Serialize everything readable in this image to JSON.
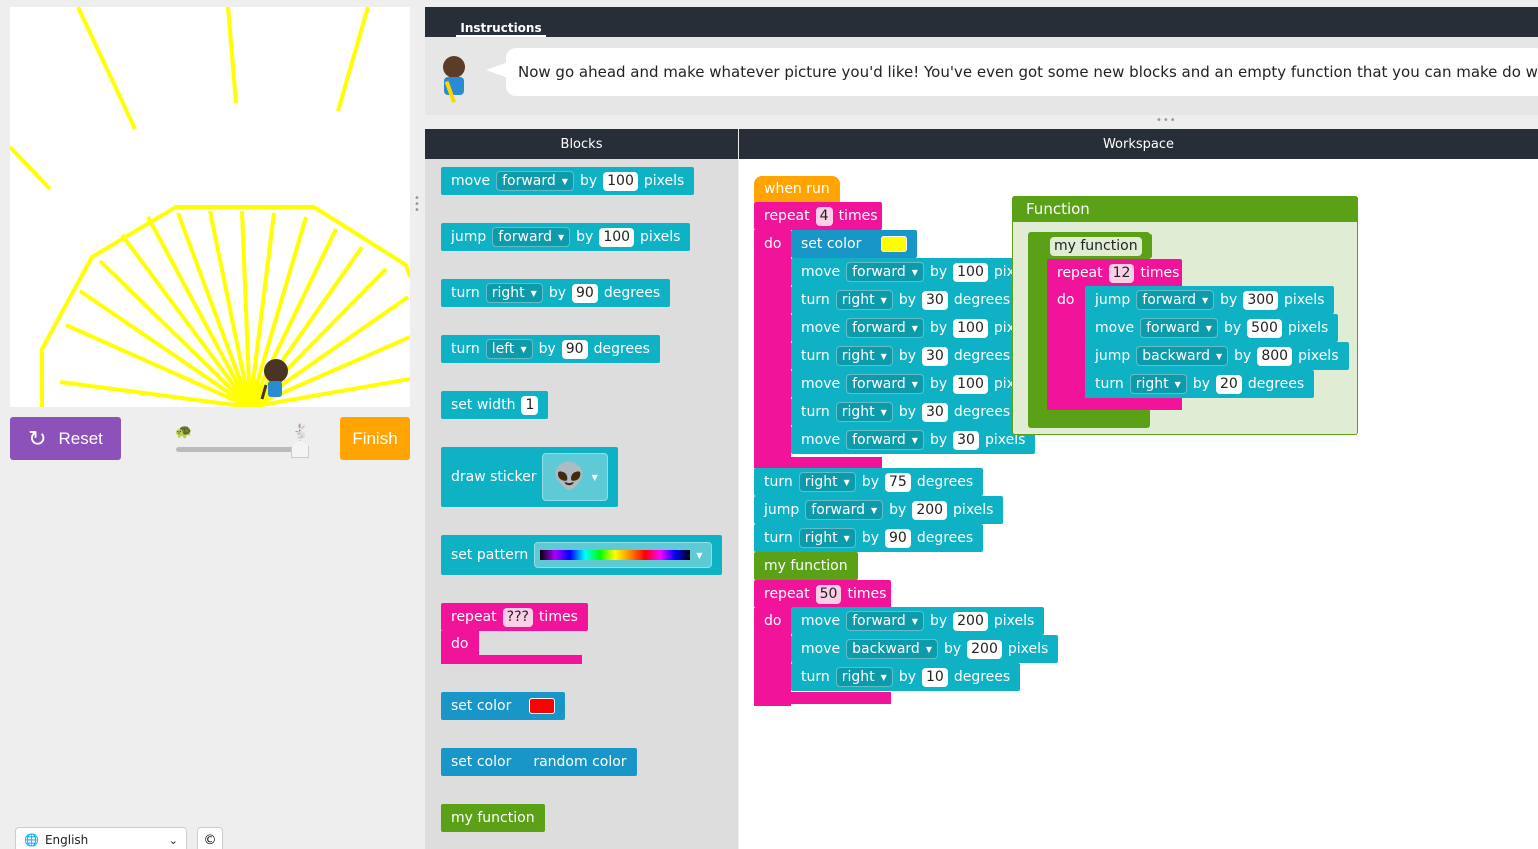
{
  "colors": {
    "reset": "#8c52ba",
    "finish": "#ffa400",
    "sun": "#ffff00"
  },
  "stage": {
    "reset_label": "Reset",
    "finish_label": "Finish"
  },
  "footer": {
    "language": "English",
    "copyright": "©"
  },
  "instructions": {
    "tab": "Instructions",
    "text": "Now go ahead and make whatever picture you'd like! You've even got some new blocks and an empty function that you can make do whatever"
  },
  "headers": {
    "blocks": "Blocks",
    "workspace": "Workspace"
  },
  "toolbox": {
    "move": {
      "verb": "move",
      "dir": "forward",
      "by": "by",
      "value": "100",
      "unit": "pixels"
    },
    "jump": {
      "verb": "jump",
      "dir": "forward",
      "by": "by",
      "value": "100",
      "unit": "pixels"
    },
    "turn_right": {
      "verb": "turn",
      "dir": "right",
      "by": "by",
      "value": "90",
      "unit": "degrees"
    },
    "turn_left": {
      "verb": "turn",
      "dir": "left",
      "by": "by",
      "value": "90",
      "unit": "degrees"
    },
    "set_width": {
      "label": "set width",
      "value": "1"
    },
    "draw_sticker": {
      "label": "draw sticker"
    },
    "set_pattern": {
      "label": "set pattern"
    },
    "repeat": {
      "label": "repeat",
      "value": "???",
      "times": "times",
      "do": "do"
    },
    "set_color_red": {
      "label": "set color",
      "color": "#ff0000"
    },
    "set_color_random": {
      "label": "set color",
      "value": "random color"
    },
    "my_function": {
      "label": "my function"
    }
  },
  "workspace": {
    "when_run": "when run",
    "repeat1": {
      "label": "repeat",
      "value": "4",
      "times": "times",
      "do": "do"
    },
    "set_color": {
      "label": "set color",
      "color": "#ffff00"
    },
    "inner": [
      {
        "verb": "move",
        "dir": "forward",
        "by": "by",
        "value": "100",
        "unit": "pixels"
      },
      {
        "verb": "turn",
        "dir": "right",
        "by": "by",
        "value": "30",
        "unit": "degrees"
      },
      {
        "verb": "move",
        "dir": "forward",
        "by": "by",
        "value": "100",
        "unit": "pixels"
      },
      {
        "verb": "turn",
        "dir": "right",
        "by": "by",
        "value": "30",
        "unit": "degrees"
      },
      {
        "verb": "move",
        "dir": "forward",
        "by": "by",
        "value": "100",
        "unit": "pixels"
      },
      {
        "verb": "turn",
        "dir": "right",
        "by": "by",
        "value": "30",
        "unit": "degrees"
      },
      {
        "verb": "move",
        "dir": "forward",
        "by": "by",
        "value": "30",
        "unit": "pixels"
      }
    ],
    "after": [
      {
        "verb": "turn",
        "dir": "right",
        "by": "by",
        "value": "75",
        "unit": "degrees"
      },
      {
        "verb": "jump",
        "dir": "forward",
        "by": "by",
        "value": "200",
        "unit": "pixels"
      },
      {
        "verb": "turn",
        "dir": "right",
        "by": "by",
        "value": "90",
        "unit": "degrees"
      }
    ],
    "call": "my function",
    "repeat2": {
      "label": "repeat",
      "value": "50",
      "times": "times",
      "do": "do"
    },
    "inner2": [
      {
        "verb": "move",
        "dir": "forward",
        "by": "by",
        "value": "200",
        "unit": "pixels"
      },
      {
        "verb": "move",
        "dir": "backward",
        "by": "by",
        "value": "200",
        "unit": "pixels"
      },
      {
        "verb": "turn",
        "dir": "right",
        "by": "by",
        "value": "10",
        "unit": "degrees"
      }
    ],
    "function": {
      "title": "Function",
      "name": "my function",
      "repeat": {
        "label": "repeat",
        "value": "12",
        "times": "times",
        "do": "do"
      },
      "body": [
        {
          "verb": "jump",
          "dir": "forward",
          "by": "by",
          "value": "300",
          "unit": "pixels"
        },
        {
          "verb": "move",
          "dir": "forward",
          "by": "by",
          "value": "500",
          "unit": "pixels"
        },
        {
          "verb": "jump",
          "dir": "backward",
          "by": "by",
          "value": "800",
          "unit": "pixels"
        },
        {
          "verb": "turn",
          "dir": "right",
          "by": "by",
          "value": "20",
          "unit": "degrees"
        }
      ]
    }
  }
}
